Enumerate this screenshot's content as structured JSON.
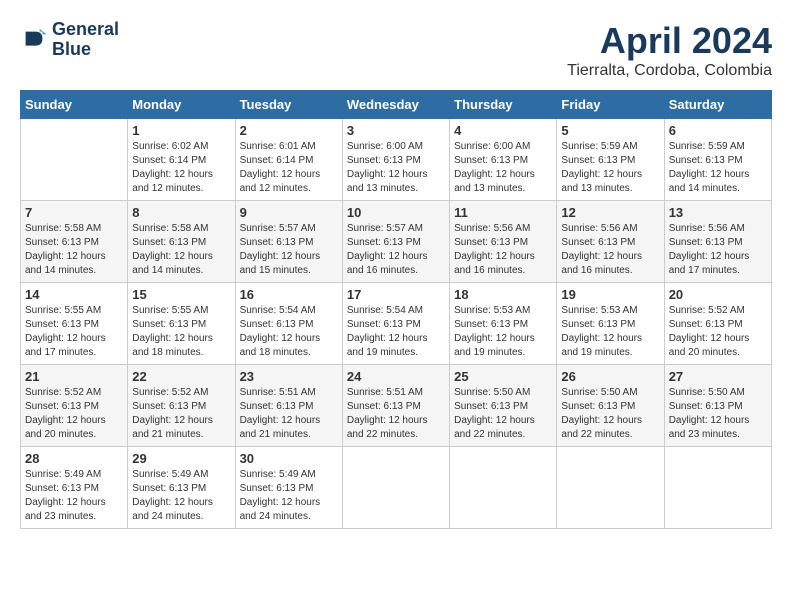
{
  "header": {
    "logo_line1": "General",
    "logo_line2": "Blue",
    "month": "April 2024",
    "location": "Tierralta, Cordoba, Colombia"
  },
  "weekdays": [
    "Sunday",
    "Monday",
    "Tuesday",
    "Wednesday",
    "Thursday",
    "Friday",
    "Saturday"
  ],
  "weeks": [
    [
      {
        "day": "",
        "info": ""
      },
      {
        "day": "1",
        "info": "Sunrise: 6:02 AM\nSunset: 6:14 PM\nDaylight: 12 hours\nand 12 minutes."
      },
      {
        "day": "2",
        "info": "Sunrise: 6:01 AM\nSunset: 6:14 PM\nDaylight: 12 hours\nand 12 minutes."
      },
      {
        "day": "3",
        "info": "Sunrise: 6:00 AM\nSunset: 6:13 PM\nDaylight: 12 hours\nand 13 minutes."
      },
      {
        "day": "4",
        "info": "Sunrise: 6:00 AM\nSunset: 6:13 PM\nDaylight: 12 hours\nand 13 minutes."
      },
      {
        "day": "5",
        "info": "Sunrise: 5:59 AM\nSunset: 6:13 PM\nDaylight: 12 hours\nand 13 minutes."
      },
      {
        "day": "6",
        "info": "Sunrise: 5:59 AM\nSunset: 6:13 PM\nDaylight: 12 hours\nand 14 minutes."
      }
    ],
    [
      {
        "day": "7",
        "info": "Sunrise: 5:58 AM\nSunset: 6:13 PM\nDaylight: 12 hours\nand 14 minutes."
      },
      {
        "day": "8",
        "info": "Sunrise: 5:58 AM\nSunset: 6:13 PM\nDaylight: 12 hours\nand 14 minutes."
      },
      {
        "day": "9",
        "info": "Sunrise: 5:57 AM\nSunset: 6:13 PM\nDaylight: 12 hours\nand 15 minutes."
      },
      {
        "day": "10",
        "info": "Sunrise: 5:57 AM\nSunset: 6:13 PM\nDaylight: 12 hours\nand 16 minutes."
      },
      {
        "day": "11",
        "info": "Sunrise: 5:56 AM\nSunset: 6:13 PM\nDaylight: 12 hours\nand 16 minutes."
      },
      {
        "day": "12",
        "info": "Sunrise: 5:56 AM\nSunset: 6:13 PM\nDaylight: 12 hours\nand 16 minutes."
      },
      {
        "day": "13",
        "info": "Sunrise: 5:56 AM\nSunset: 6:13 PM\nDaylight: 12 hours\nand 17 minutes."
      }
    ],
    [
      {
        "day": "14",
        "info": "Sunrise: 5:55 AM\nSunset: 6:13 PM\nDaylight: 12 hours\nand 17 minutes."
      },
      {
        "day": "15",
        "info": "Sunrise: 5:55 AM\nSunset: 6:13 PM\nDaylight: 12 hours\nand 18 minutes."
      },
      {
        "day": "16",
        "info": "Sunrise: 5:54 AM\nSunset: 6:13 PM\nDaylight: 12 hours\nand 18 minutes."
      },
      {
        "day": "17",
        "info": "Sunrise: 5:54 AM\nSunset: 6:13 PM\nDaylight: 12 hours\nand 19 minutes."
      },
      {
        "day": "18",
        "info": "Sunrise: 5:53 AM\nSunset: 6:13 PM\nDaylight: 12 hours\nand 19 minutes."
      },
      {
        "day": "19",
        "info": "Sunrise: 5:53 AM\nSunset: 6:13 PM\nDaylight: 12 hours\nand 19 minutes."
      },
      {
        "day": "20",
        "info": "Sunrise: 5:52 AM\nSunset: 6:13 PM\nDaylight: 12 hours\nand 20 minutes."
      }
    ],
    [
      {
        "day": "21",
        "info": "Sunrise: 5:52 AM\nSunset: 6:13 PM\nDaylight: 12 hours\nand 20 minutes."
      },
      {
        "day": "22",
        "info": "Sunrise: 5:52 AM\nSunset: 6:13 PM\nDaylight: 12 hours\nand 21 minutes."
      },
      {
        "day": "23",
        "info": "Sunrise: 5:51 AM\nSunset: 6:13 PM\nDaylight: 12 hours\nand 21 minutes."
      },
      {
        "day": "24",
        "info": "Sunrise: 5:51 AM\nSunset: 6:13 PM\nDaylight: 12 hours\nand 22 minutes."
      },
      {
        "day": "25",
        "info": "Sunrise: 5:50 AM\nSunset: 6:13 PM\nDaylight: 12 hours\nand 22 minutes."
      },
      {
        "day": "26",
        "info": "Sunrise: 5:50 AM\nSunset: 6:13 PM\nDaylight: 12 hours\nand 22 minutes."
      },
      {
        "day": "27",
        "info": "Sunrise: 5:50 AM\nSunset: 6:13 PM\nDaylight: 12 hours\nand 23 minutes."
      }
    ],
    [
      {
        "day": "28",
        "info": "Sunrise: 5:49 AM\nSunset: 6:13 PM\nDaylight: 12 hours\nand 23 minutes."
      },
      {
        "day": "29",
        "info": "Sunrise: 5:49 AM\nSunset: 6:13 PM\nDaylight: 12 hours\nand 24 minutes."
      },
      {
        "day": "30",
        "info": "Sunrise: 5:49 AM\nSunset: 6:13 PM\nDaylight: 12 hours\nand 24 minutes."
      },
      {
        "day": "",
        "info": ""
      },
      {
        "day": "",
        "info": ""
      },
      {
        "day": "",
        "info": ""
      },
      {
        "day": "",
        "info": ""
      }
    ]
  ]
}
